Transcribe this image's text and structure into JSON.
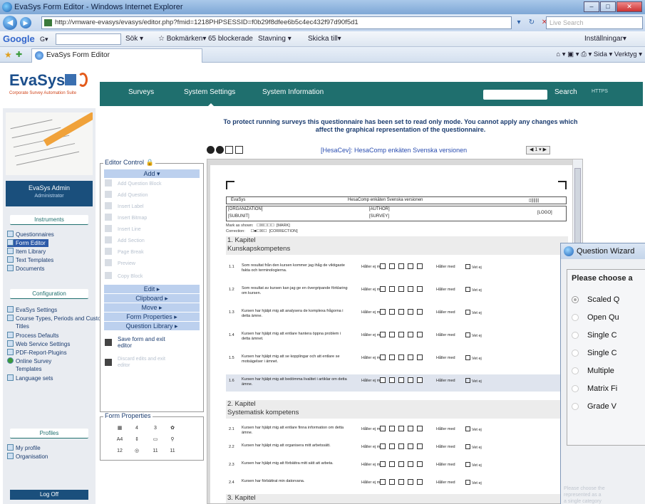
{
  "browser": {
    "title": "EvaSys Form Editor - Windows Internet Explorer",
    "url": "http://vmware-evasys/evasys/editor.php?fmid=1218PHPSESSID=f0b29f8dfee6b5c4ec432f97d90f5d1",
    "search_placeholder": "Live Search",
    "win_minimize": "–",
    "win_maximize": "□",
    "win_close": "✕",
    "toolbar_google": "Google",
    "toolbar_g": "G▾",
    "toolbar_items": [
      "Sök ▾",
      "☆ Bokmärken▾",
      "65 blockerade",
      "Stavning ▾",
      "Skicka till▾"
    ],
    "toolbar_settings": "Inställningar▾",
    "tab_title": "EvaSys Form Editor",
    "cmd_items": "⌂ ▾  ▣ ▾  ⎙ ▾  Sida ▾  Verktyg ▾"
  },
  "header": {
    "logo": "EvaSys",
    "logo_sub": "Corporate Survey Automation Suite",
    "nav": [
      "Surveys",
      "System Settings",
      "System Information"
    ],
    "search_label": "Search",
    "https": "HTTPS"
  },
  "sidebar": {
    "user_name": "EvaSys Admin",
    "user_role": "Administrator",
    "sections": {
      "instruments": {
        "title": "Instruments",
        "items": [
          "Questionnaires",
          "Form Editor",
          "Item Library",
          "Text Templates",
          "Documents"
        ]
      },
      "configuration": {
        "title": "Configuration",
        "items": [
          "EvaSys Settings",
          "Course Types, Periods and Custom",
          "Titles",
          "Process Defaults",
          "Web Service Settings",
          "PDF-Report-Plugins",
          "Online Survey",
          "Templates",
          "Language sets"
        ]
      },
      "profiles": {
        "title": "Profiles",
        "items": [
          "My profile",
          "Organisation"
        ]
      }
    },
    "logoff": "Log Off"
  },
  "editor_control": {
    "title": "Editor Control",
    "add": "Add ▾",
    "disabled_items": [
      "Add Question Block",
      "Add Question",
      "Insert Label",
      "Insert Bitmap",
      "Insert Line",
      "Add Section",
      "Page Break",
      "Preview",
      "Copy Block"
    ],
    "edit": "Edit ▸",
    "clipboard": "Clipboard ▸",
    "move": "Move ▸",
    "form_properties": "Form Properties ▸",
    "question_library": "Question Library ▸",
    "save_exit": [
      "Save form and exit",
      "editor"
    ],
    "discard": [
      "Discard edits and exit",
      "editor"
    ]
  },
  "form_properties_panel": {
    "title": "Form Properties",
    "cells": [
      "4",
      "3",
      "A4",
      "12",
      "11",
      "11"
    ]
  },
  "main": {
    "readonly_msg": [
      "To protect running surveys this questionnaire has been set to read only mode. You cannot apply any changes which",
      "affect the graphical representation of the questionnaire."
    ],
    "form_title": "[HesaCev]: HesaComp enkäten Svenska versionen",
    "page_indicator": "◀ 1 ▾ ▶",
    "sheet": {
      "hdr_evasys": "EvaSys",
      "hdr_formname": "HesaComp enkäten Svenska versionen",
      "hdr_barcode": "▯|||||||",
      "organization": "[ORGANIZATION]",
      "author": "[AUTHOR]",
      "subunit": "[SUBUNIT]",
      "survey": "[SURVEY]",
      "logo": "[LOGO]",
      "mark_as_shown": "Mark as shown:",
      "mark_as_shown_tag": "[MARK]",
      "correction": "Correction:",
      "correction_tag": "[CORRECTION]",
      "sections": [
        {
          "label": "1. Kapitel",
          "sub": "Kunskapskompetens"
        },
        {
          "label": "2. Kapitel",
          "sub": "Systematisk kompetens"
        },
        {
          "label": "3. Kapitel",
          "sub": ""
        }
      ],
      "lo_label": "Håller ej med",
      "hi_label": "Håller med",
      "na_label": "Vet ej",
      "questions_s1": [
        {
          "num": "1.1",
          "text": "Som resultat från den kursen kommer jag ihåg de viktigaste fakta och terminologierna."
        },
        {
          "num": "1.2",
          "text": "Som resultat av kursen kan jag ge en övergripande förklaring om kursen."
        },
        {
          "num": "1.3",
          "text": "Kursen har hjälpt mig att analysera de komplexa frågorna i detta ämne."
        },
        {
          "num": "1.4",
          "text": "Kursen har hjälpt mig att entlare hantera öppna problem i detta ämnet."
        },
        {
          "num": "1.5",
          "text": "Kursen har hjälpt mig att se kopplingar och att entlare se motsägelser i ämnet."
        },
        {
          "num": "1.6",
          "text": "Kursen har hjälpt mig att bedömma livalitet i artiklar om detta ämne."
        }
      ],
      "questions_s2": [
        {
          "num": "2.1",
          "text": "Kursen har hjälpt mig att entlare finna information om detta ämne."
        },
        {
          "num": "2.2",
          "text": "Kursen har hjälpt mig att organisera mitt arbetssätt."
        },
        {
          "num": "2.3",
          "text": "Kursen har hjälpt mig att förbättra mitt sätt att arbeta."
        },
        {
          "num": "2.4",
          "text": "Kursen har förbättrat min datorvana."
        }
      ]
    }
  },
  "wizard": {
    "title": "Question Wizard",
    "prompt": "Please choose a",
    "options": [
      "Scaled Q",
      "Open Qu",
      "Single C",
      "Single C",
      "Multiple",
      "Matrix Fi",
      "Grade V"
    ],
    "help": [
      "Please choose the",
      "represented as a",
      "a single category"
    ]
  }
}
